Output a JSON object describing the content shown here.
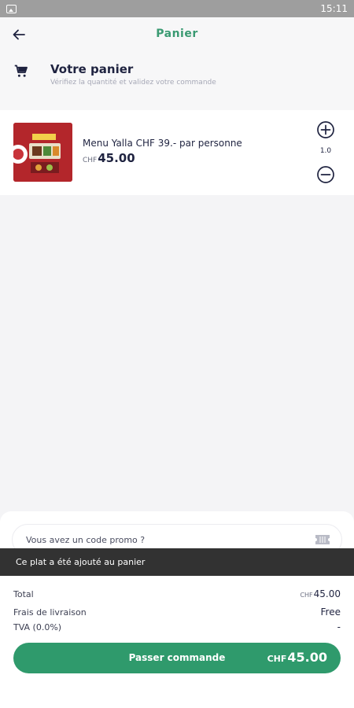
{
  "status_bar": {
    "time": "15:11",
    "icon": "image-icon"
  },
  "header": {
    "title": "Panier",
    "back_icon": "arrow-left-icon"
  },
  "cart_header": {
    "icon": "cart-icon",
    "title": "Votre panier",
    "subtitle": "Vérifiez la quantité et validez votre commande"
  },
  "cart_items": [
    {
      "name": "Menu Yalla CHF 39.- par personne",
      "currency": "CHF",
      "price": "45.00",
      "quantity": "1.0"
    }
  ],
  "promo": {
    "placeholder": "Vous avez un code promo ?",
    "icon": "ticket-icon"
  },
  "snackbar": {
    "message": "Ce plat a été ajouté au panier"
  },
  "summary": {
    "total_label": "Total",
    "total_currency": "CHF",
    "total_value": "45.00",
    "delivery_label": "Frais de livraison",
    "delivery_value": "Free",
    "tax_label": "TVA (0.0%)",
    "tax_value": "-"
  },
  "checkout": {
    "label": "Passer commande",
    "currency": "CHF",
    "amount": "45.00"
  },
  "colors": {
    "accent": "#2f9a6c",
    "title_green": "#3a9a72",
    "text_dark": "#1f2340",
    "snackbar": "#323232"
  }
}
